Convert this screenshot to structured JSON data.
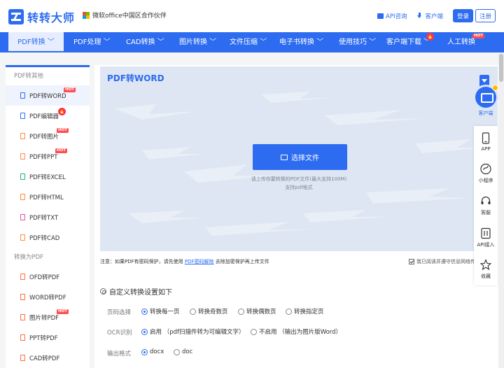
{
  "header": {
    "logo_text": "转转大师",
    "partner_text": "微软office中国区合作伙伴",
    "api_link": "API咨询",
    "client_link": "客户端",
    "login": "登录",
    "register": "注册"
  },
  "nav": [
    {
      "label": "PDF转换 ﹀"
    },
    {
      "label": "PDF处理 ﹀"
    },
    {
      "label": "CAD转换 ﹀"
    },
    {
      "label": "图片转换 ﹀"
    },
    {
      "label": "文件压缩 ﹀"
    },
    {
      "label": "电子书转换 ﹀"
    },
    {
      "label": "使用技巧 ﹀"
    },
    {
      "label": "客户端下载 ﹀"
    },
    {
      "label": "人工转换"
    }
  ],
  "badges": {
    "hot": "HOT",
    "fire": "🔥"
  },
  "sidebar": {
    "section1": "PDF转其他",
    "items1": [
      {
        "label": "PDF转WORD"
      },
      {
        "label": "PDF编辑器"
      },
      {
        "label": "PDF转图片"
      },
      {
        "label": "PDF转PPT"
      },
      {
        "label": "PDF转EXCEL"
      },
      {
        "label": "PDF转HTML"
      },
      {
        "label": "PDF转TXT"
      },
      {
        "label": "PDF转CAD"
      }
    ],
    "section2": "转换为PDF",
    "items2": [
      {
        "label": "OFD转PDF"
      },
      {
        "label": "WORD转PDF"
      },
      {
        "label": "图片转PDF"
      },
      {
        "label": "PPT转PDF"
      },
      {
        "label": "CAD转PDF"
      }
    ]
  },
  "upload": {
    "title": "PDF转WORD",
    "button": "选择文件",
    "hint1": "请上传你要转换的PDF文件(最大支持100M)",
    "hint2": "支持pdf格式"
  },
  "notice": {
    "prefix": "注意：如果PDF有密码保护，请先使用",
    "link": "PDF密码解除",
    "suffix": "去除加密保护再上传文件",
    "agree": "我已阅读并遵守信息网络传播权保护"
  },
  "settings": {
    "title": "自定义转换设置如下",
    "page_label": "页码选择",
    "page_options": [
      "转换每一页",
      "转换奇数页",
      "转换偶数页",
      "转换指定页"
    ],
    "ocr_label": "OCR识别",
    "ocr_options": [
      "启用 （pdf扫描件转为可编辑文字）",
      "不启用 （输出为图片版Word）"
    ],
    "format_label": "输出格式",
    "format_options": [
      "docx",
      "doc"
    ]
  },
  "float": {
    "client": "客户端",
    "items": [
      {
        "label": "APP",
        "icon": "phone-icon"
      },
      {
        "label": "小程序",
        "icon": "mini-program-icon"
      },
      {
        "label": "客服",
        "icon": "headset-icon"
      },
      {
        "label": "API接入",
        "icon": "api-icon"
      },
      {
        "label": "收藏",
        "icon": "star-icon"
      }
    ]
  },
  "colors": {
    "brand": "#2d6cf0",
    "hot": "#ff4d4f",
    "upload_bg": "#dde6f2"
  }
}
